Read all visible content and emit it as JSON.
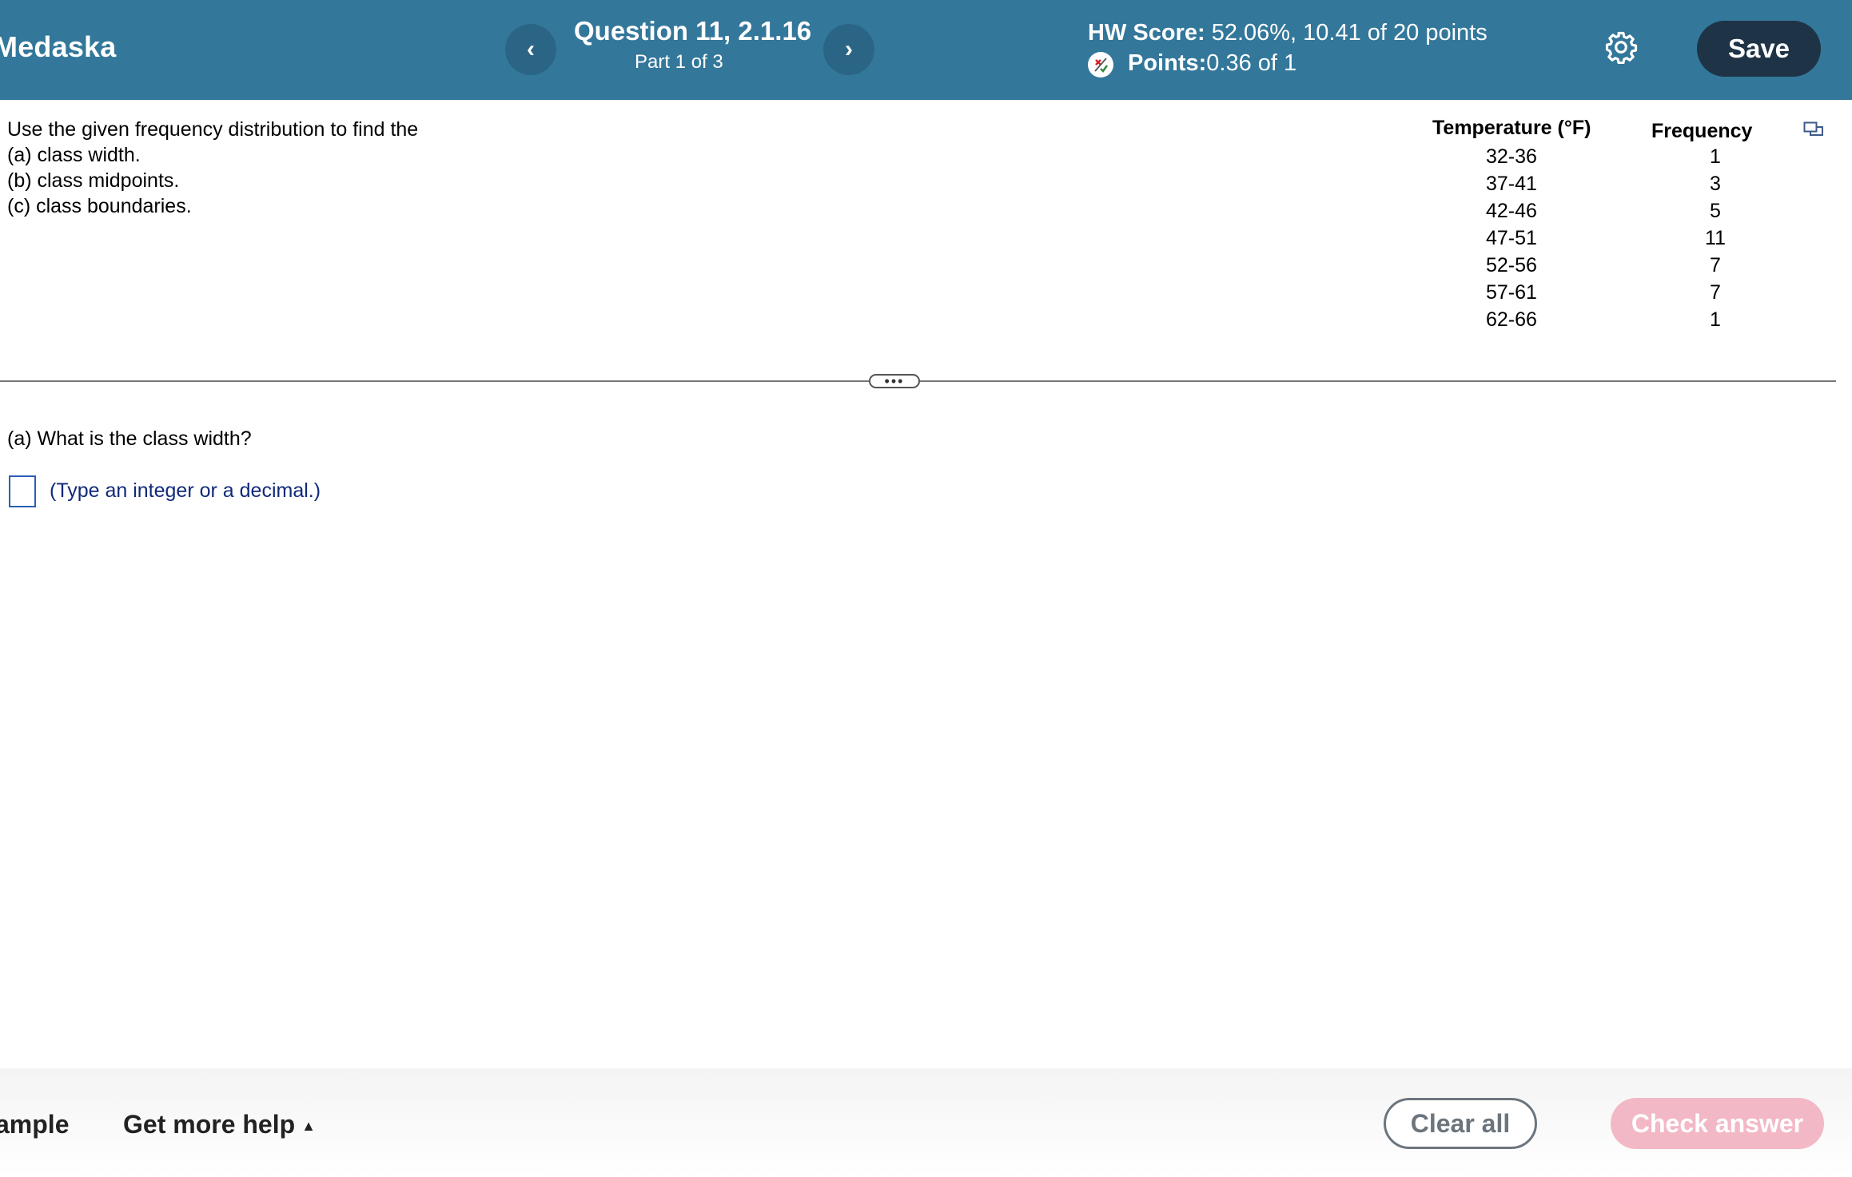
{
  "header": {
    "student_name": "Medaska",
    "prev_symbol": "‹",
    "next_symbol": "›",
    "question_title": "Question 11, 2.1.16",
    "question_part": "Part 1 of 3",
    "hw_score_label": "HW Score:",
    "hw_score_value": " 52.06%, 10.41 of 20 points",
    "points_label": "Points:",
    "points_value": " 0.36 of 1",
    "save_label": "Save",
    "colors": {
      "bar": "#33779a",
      "save_button": "#1e3346"
    },
    "icons": [
      "chevron-left-icon",
      "chevron-right-icon",
      "partial-credit-icon",
      "gear-icon"
    ]
  },
  "problem": {
    "lines": [
      "Use the given frequency distribution to find the",
      "(a) class width.",
      "(b) class midpoints.",
      "(c) class boundaries."
    ]
  },
  "frequency_table": {
    "headers": [
      "Temperature (°F)",
      "Frequency"
    ],
    "rows": [
      [
        "32-36",
        "1"
      ],
      [
        "37-41",
        "3"
      ],
      [
        "42-46",
        "5"
      ],
      [
        "47-51",
        "11"
      ],
      [
        "52-56",
        "7"
      ],
      [
        "57-61",
        "7"
      ],
      [
        "62-66",
        "1"
      ]
    ],
    "popout_icon": "popout-icon"
  },
  "divider": {
    "handle_label": "•••"
  },
  "answer": {
    "question": "(a) What is the class width?",
    "value": "",
    "hint": "(Type an integer or a decimal.)"
  },
  "footer": {
    "example_label": "ample",
    "help_label": "Get more help",
    "help_caret": "▲",
    "clear_label": "Clear all",
    "check_label": "Check answer",
    "colors": {
      "check_button": "#f2b8c6",
      "clear_border": "#6c757d"
    }
  }
}
